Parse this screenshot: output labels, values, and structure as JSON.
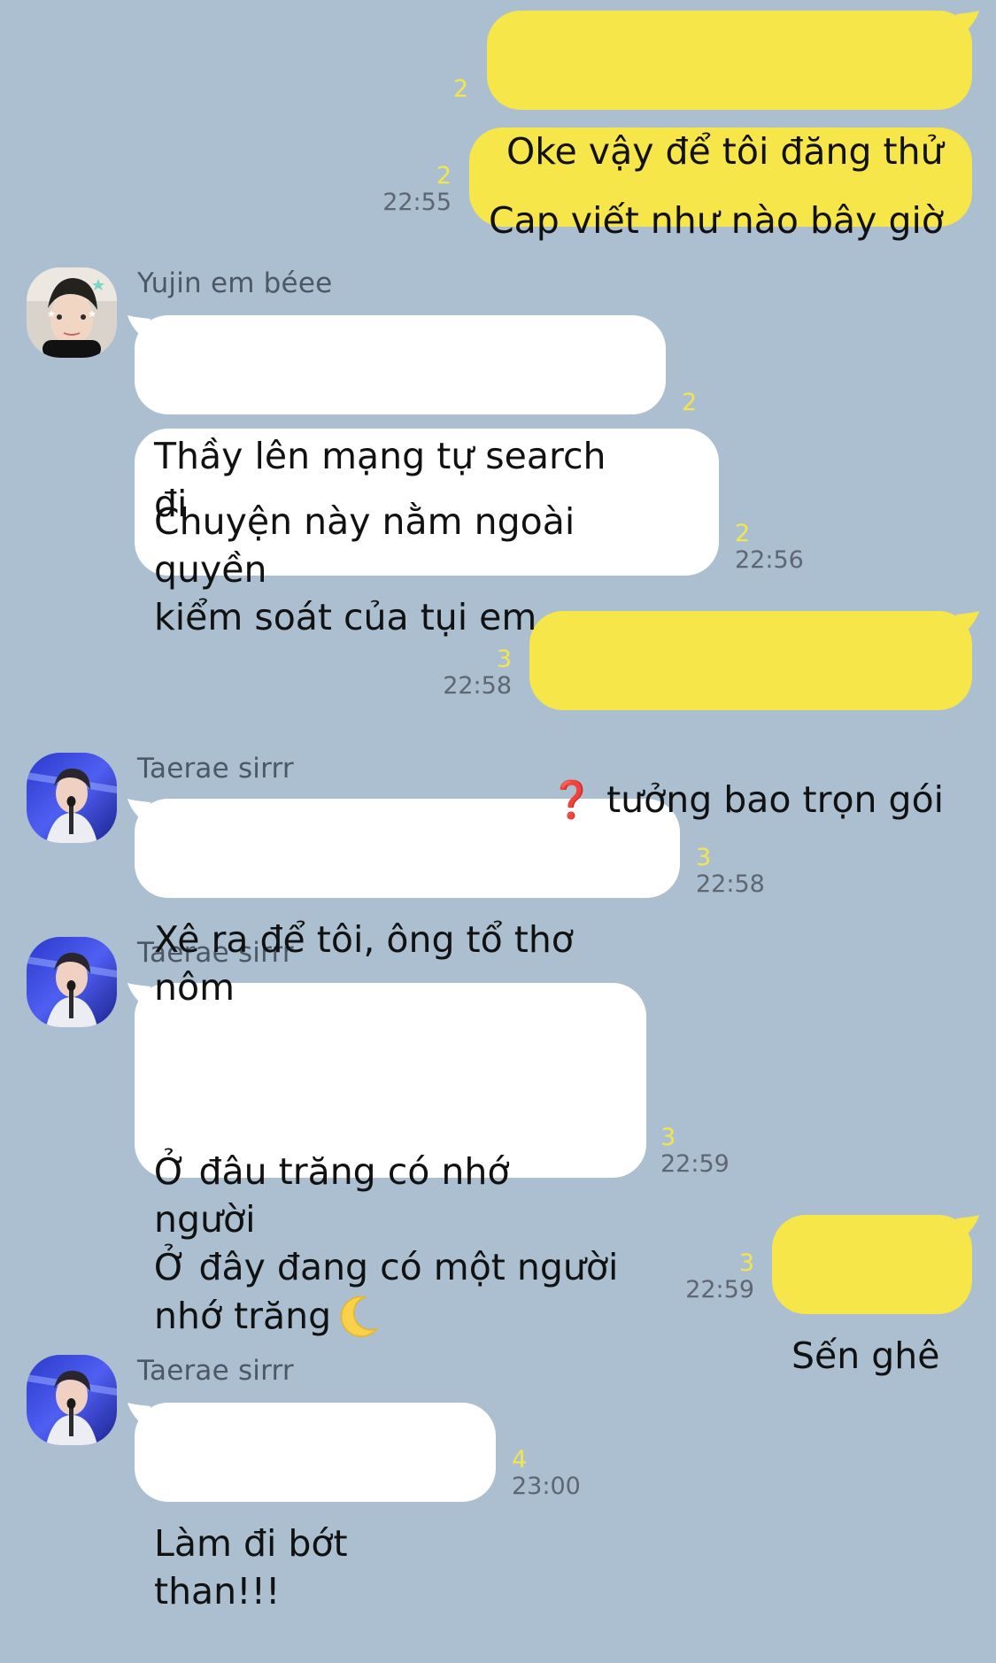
{
  "messages": [
    {
      "id": "m1",
      "direction": "out",
      "text": "Oke vậy để tôi đăng thử",
      "read_count": "2",
      "time": ""
    },
    {
      "id": "m2",
      "direction": "out",
      "text": "Cap viết như nào bây giờ",
      "read_count": "2",
      "time": "22:55"
    },
    {
      "id": "m3",
      "direction": "in",
      "sender": "Yujin em béee",
      "text": "Thầy lên mạng tự search đi",
      "read_count": "2",
      "time": ""
    },
    {
      "id": "m4",
      "direction": "in",
      "text": "Chuyện này nằm ngoài quyền\nkiểm soát của tụi em",
      "read_count": "2",
      "time": "22:56"
    },
    {
      "id": "m5",
      "direction": "out",
      "text_prefix_icon": "red-question-mark-icon",
      "text": "tưởng bao trọn gói",
      "read_count": "3",
      "time": "22:58"
    },
    {
      "id": "m6",
      "direction": "in",
      "sender": "Taerae sirrr",
      "text": "Xê ra để tôi, ông tổ thơ nôm",
      "read_count": "3",
      "time": "22:58"
    },
    {
      "id": "m7",
      "direction": "in",
      "sender": "Taerae sirrr",
      "text": "Ở đâu trăng có nhớ người\nỞ đây đang có một người\nnhớ trăng",
      "suffix_icon": "crescent-moon-icon",
      "read_count": "3",
      "time": "22:59"
    },
    {
      "id": "m8",
      "direction": "out",
      "text": "Sến ghê",
      "read_count": "3",
      "time": "22:59"
    },
    {
      "id": "m9",
      "direction": "in",
      "sender": "Taerae sirrr",
      "text": "Làm đi bớt than!!!",
      "read_count": "4",
      "time": "23:00"
    }
  ],
  "colors": {
    "background": "#abbfd0",
    "incoming_bubble": "#ffffff",
    "outgoing_bubble": "#f7e64a",
    "read_count": "#f4e64a",
    "timestamp": "#5f6672",
    "sender_name": "#4d5867"
  },
  "icons": {
    "red_question_mark": "red-question-mark-icon",
    "moon": "crescent-moon-icon",
    "avatar_yujin": "avatar-yujin",
    "avatar_taerae": "avatar-taerae"
  }
}
